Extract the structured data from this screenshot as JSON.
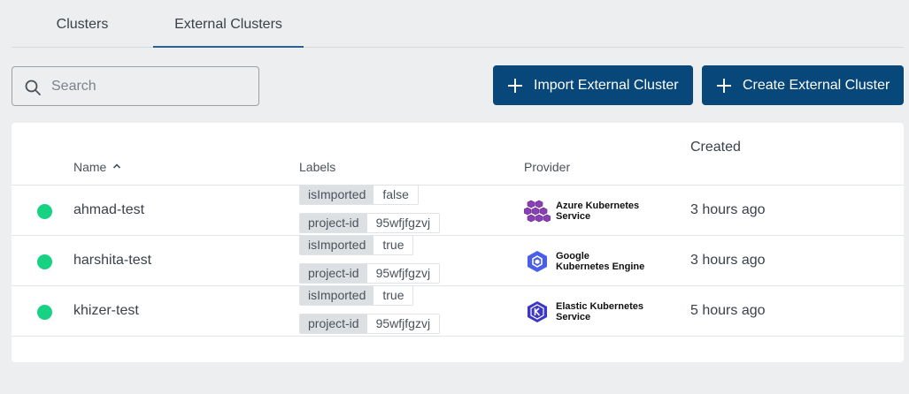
{
  "tabs": [
    {
      "label": "Clusters"
    },
    {
      "label": "External Clusters"
    }
  ],
  "search": {
    "placeholder": "Search"
  },
  "buttons": {
    "import_label": "Import External Cluster",
    "create_label": "Create External Cluster"
  },
  "table": {
    "headers": {
      "name": "Name",
      "labels": "Labels",
      "provider": "Provider",
      "created": "Created"
    },
    "sort": {
      "column": "Name",
      "direction": "ascending"
    },
    "rows": [
      {
        "status_color": "#17d283",
        "name": "ahmad-test",
        "labels": [
          {
            "key": "isImported",
            "value": "false"
          },
          {
            "key": "project-id",
            "value": "95wfjfgzvj"
          }
        ],
        "provider": {
          "line1": "Azure Kubernetes",
          "line2": "Service",
          "icon": "azure-aks-icon"
        },
        "created": "3 hours ago"
      },
      {
        "status_color": "#17d283",
        "name": "harshita-test",
        "labels": [
          {
            "key": "isImported",
            "value": "true"
          },
          {
            "key": "project-id",
            "value": "95wfjfgzvj"
          }
        ],
        "provider": {
          "line1": "Google",
          "line2": "Kubernetes Engine",
          "icon": "google-gke-icon"
        },
        "created": "3 hours ago"
      },
      {
        "status_color": "#17d283",
        "name": "khizer-test",
        "labels": [
          {
            "key": "isImported",
            "value": "true"
          },
          {
            "key": "project-id",
            "value": "95wfjfgzvj"
          }
        ],
        "provider": {
          "line1": "Elastic Kubernetes",
          "line2": "Service",
          "icon": "amazon-eks-icon"
        },
        "created": "5 hours ago"
      }
    ]
  },
  "colors": {
    "accent": "#07477a",
    "tab_underline": "#2a5f8f",
    "status_ok": "#17d283",
    "background": "#eceef0"
  }
}
